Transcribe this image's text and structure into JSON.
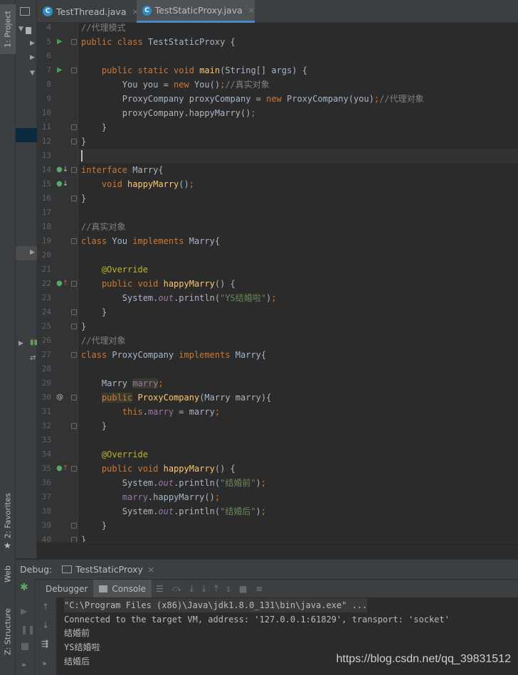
{
  "strip": {
    "project": "1: Project",
    "favorites": "2: Favorites",
    "web": "Web",
    "structure": "Z: Structure"
  },
  "tabs": [
    {
      "label": "TestThread.java",
      "close": "×"
    },
    {
      "label": "TestStaticProxy.java",
      "close": "×"
    }
  ],
  "code": [
    {
      "n": "4",
      "html": "<span class=\"cm\">//代理模式</span>"
    },
    {
      "n": "5",
      "html": "<span class=\"kw\">public class </span>TestStaticProxy {"
    },
    {
      "n": "6",
      "html": ""
    },
    {
      "n": "7",
      "html": "    <span class=\"kw\">public static void </span><span class=\"fn\">main</span>(String[] args) {"
    },
    {
      "n": "8",
      "html": "        You you = <span class=\"kw\">new </span>You()<span class=\"kw\">;</span><span class=\"cm\">//真实对象</span>"
    },
    {
      "n": "9",
      "html": "        ProxyCompany proxyCompany = <span class=\"kw\">new </span>ProxyCompany(you)<span class=\"kw\">;</span><span class=\"cm\">//代理对象</span>"
    },
    {
      "n": "10",
      "html": "        proxyCompany.happyMarry()<span class=\"kw\">;</span>"
    },
    {
      "n": "11",
      "html": "    }"
    },
    {
      "n": "12",
      "html": "}"
    },
    {
      "n": "13",
      "html": ""
    },
    {
      "n": "14",
      "html": "<span class=\"kw\">interface </span>Marry{"
    },
    {
      "n": "15",
      "html": "    <span class=\"kw\">void </span><span class=\"fn\">happyMarry</span>()<span class=\"kw\">;</span>"
    },
    {
      "n": "16",
      "html": "}"
    },
    {
      "n": "17",
      "html": ""
    },
    {
      "n": "18",
      "html": "<span class=\"cm\">//真实对象</span>"
    },
    {
      "n": "19",
      "html": "<span class=\"kw\">class </span>You <span class=\"kw\">implements </span>Marry{"
    },
    {
      "n": "20",
      "html": ""
    },
    {
      "n": "21",
      "html": "    <span class=\"an\">@Override</span>"
    },
    {
      "n": "22",
      "html": "    <span class=\"kw\">public void </span><span class=\"fn\">happyMarry</span>() {"
    },
    {
      "n": "23",
      "html": "        System.<span class=\"it\">out</span>.println(<span class=\"st\">\"YS结婚啦\"</span>)<span class=\"kw\">;</span>"
    },
    {
      "n": "24",
      "html": "    }"
    },
    {
      "n": "25",
      "html": "}"
    },
    {
      "n": "26",
      "html": "<span class=\"cm\">//代理对象</span>"
    },
    {
      "n": "27",
      "html": "<span class=\"kw\">class </span>ProxyCompany <span class=\"kw\">implements </span>Marry{"
    },
    {
      "n": "28",
      "html": ""
    },
    {
      "n": "29",
      "html": "    Marry <span class=\"fld hl\">marry</span><span class=\"kw\">;</span>"
    },
    {
      "n": "30",
      "html": "    <span class=\"kw hl\">public</span> <span class=\"fn\">ProxyCompany</span>(Marry marry){"
    },
    {
      "n": "31",
      "html": "        <span class=\"kw\">this</span>.<span class=\"fld\">marry </span>= marry<span class=\"kw\">;</span>"
    },
    {
      "n": "32",
      "html": "    }"
    },
    {
      "n": "33",
      "html": ""
    },
    {
      "n": "34",
      "html": "    <span class=\"an\">@Override</span>"
    },
    {
      "n": "35",
      "html": "    <span class=\"kw\">public void </span><span class=\"fn\">happyMarry</span>() {"
    },
    {
      "n": "36",
      "html": "        System.<span class=\"it\">out</span>.println(<span class=\"st\">\"结婚前\"</span>)<span class=\"kw\">;</span>"
    },
    {
      "n": "37",
      "html": "        <span class=\"fld\">marry</span>.happyMarry()<span class=\"kw\">;</span>"
    },
    {
      "n": "38",
      "html": "        System.<span class=\"it\">out</span>.println(<span class=\"st\">\"结婚后\"</span>)<span class=\"kw\">;</span>"
    },
    {
      "n": "39",
      "html": "    }"
    },
    {
      "n": "40",
      "html": "}"
    }
  ],
  "debug": {
    "label": "Debug:",
    "config": "TestStaticProxy",
    "close": "×",
    "tab_debugger": "Debugger",
    "tab_console": "Console"
  },
  "console": [
    "\"C:\\Program Files (x86)\\Java\\jdk1.8.0_131\\bin\\java.exe\" ...",
    "Connected to the target VM, address: '127.0.0.1:61829', transport: 'socket'",
    "结婚前",
    "YS结婚啦",
    "结婚后"
  ],
  "watermark": "https://blog.csdn.net/qq_39831512",
  "colors": {
    "keyword": "#cc7832",
    "comment": "#808080",
    "string": "#6a8759",
    "method": "#ffc66d",
    "annotation": "#bbb529",
    "field": "#9876aa"
  }
}
